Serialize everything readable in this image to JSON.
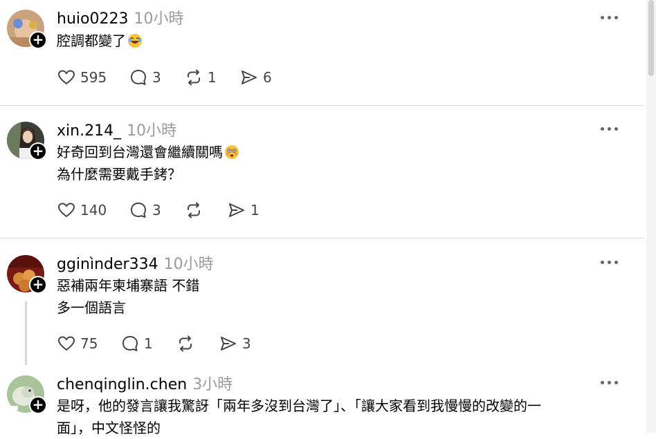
{
  "posts": [
    {
      "username": "huio0223",
      "time": "10小時",
      "lines": [
        "腔調都變了"
      ],
      "emoji": "laughing-face",
      "likes": "595",
      "replies": "3",
      "reposts": "1",
      "shares": "6"
    },
    {
      "username": "xin.214_",
      "time": "10小時",
      "lines": [
        "好奇回到台灣還會繼續關嗎",
        "為什麼需要戴手銬？"
      ],
      "emoji": "flushed-face",
      "likes": "140",
      "replies": "3",
      "reposts": "",
      "shares": "1"
    },
    {
      "username": "gginìnder334",
      "time": "10小時",
      "lines": [
        "惡補兩年柬埔寨語 不錯",
        "多一個語言"
      ],
      "likes": "75",
      "replies": "1",
      "reposts": "",
      "shares": "3"
    },
    {
      "username": "chenqinglin.chen",
      "time": "3小時",
      "lines": [
        "是呀，他的發言讓我驚訝「兩年多沒到台灣了」、「讓大家看到我慢慢的改變的一",
        "面」，中文怪怪的"
      ]
    }
  ],
  "colors": {
    "text": "#000000",
    "muted": "#9a9a9a",
    "icon": "#444444",
    "divider": "#d9d9d9"
  }
}
